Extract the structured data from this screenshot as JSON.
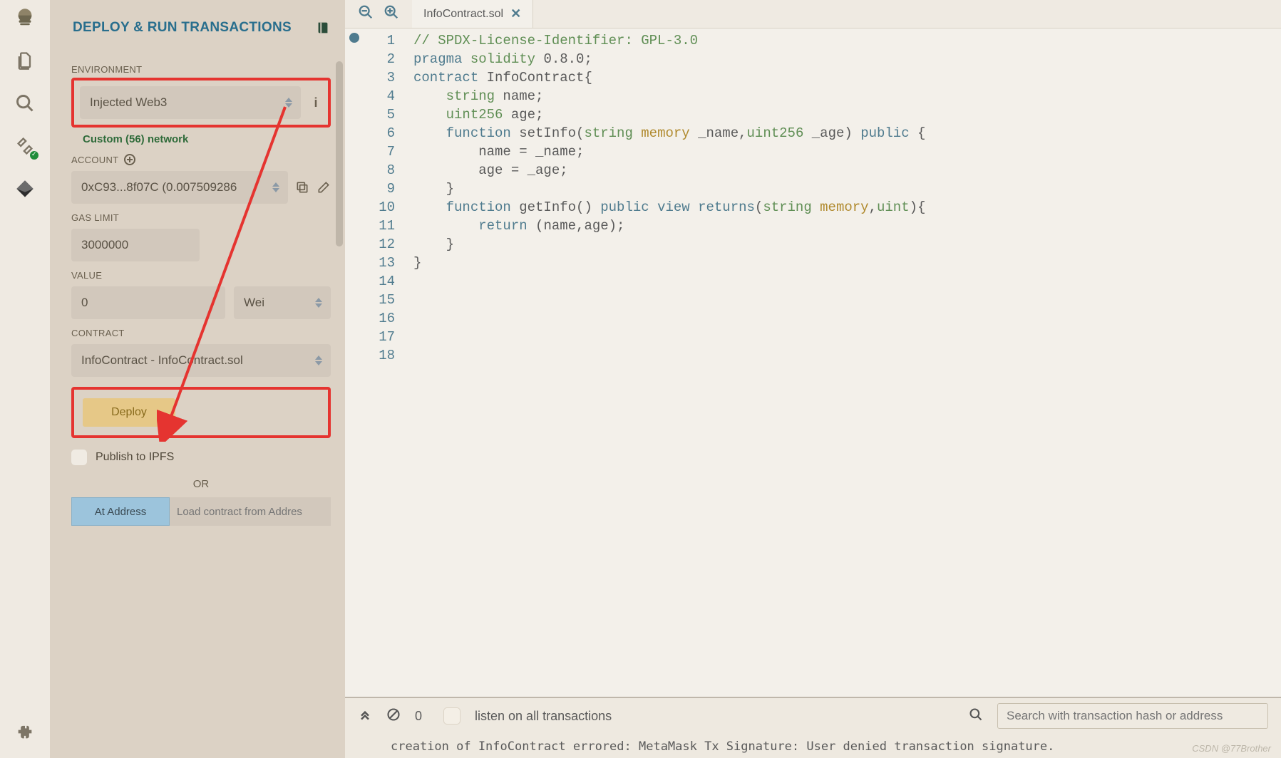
{
  "header": {
    "title": "DEPLOY & RUN TRANSACTIONS"
  },
  "labels": {
    "environment": "ENVIRONMENT",
    "account": "ACCOUNT",
    "gas_limit": "GAS LIMIT",
    "value": "VALUE",
    "contract": "CONTRACT",
    "or": "OR",
    "publish_ipfs": "Publish to IPFS",
    "at_address": "At Address",
    "load_placeholder": "Load contract from Addres"
  },
  "env": {
    "selected": "Injected Web3",
    "network_note": "Custom (56) network"
  },
  "account": {
    "display": "0xC93...8f07C (0.007509286"
  },
  "gas_limit": {
    "value": "3000000"
  },
  "value": {
    "amount": "0",
    "unit": "Wei"
  },
  "contract": {
    "selected": "InfoContract - InfoContract.sol"
  },
  "deploy": {
    "label": "Deploy"
  },
  "tab": {
    "name": "InfoContract.sol"
  },
  "code": {
    "lines": [
      "// SPDX-License-Identifier: GPL-3.0",
      "",
      "pragma solidity 0.8.0;",
      "",
      "contract InfoContract{",
      "    string name;",
      "    uint256 age;",
      "",
      "    function setInfo(string memory _name,uint256 _age) public {",
      "        name = _name;",
      "        age = _age;",
      "",
      "    }",
      "",
      "    function getInfo() public view returns(string memory,uint){",
      "        return (name,age);",
      "    }",
      "}"
    ],
    "current_line": 12,
    "count": 18
  },
  "terminal": {
    "pending": "0",
    "listen_label": "listen on all transactions",
    "search_placeholder": "Search with transaction hash or address",
    "log": "creation of InfoContract errored: MetaMask Tx Signature: User denied transaction signature."
  },
  "watermark": "CSDN @77Brother"
}
